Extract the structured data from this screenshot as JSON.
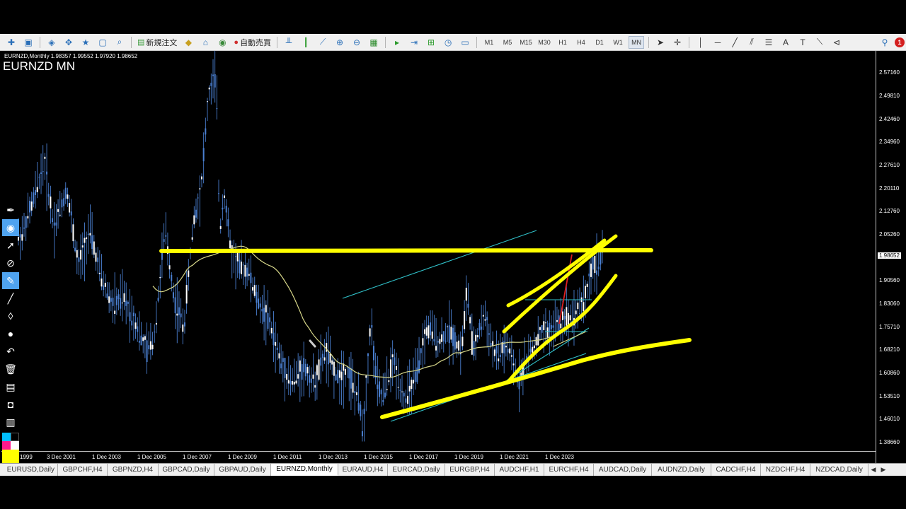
{
  "toolbar": {
    "new_order_label": "新規注文",
    "auto_trading_label": "自動売買",
    "timeframes": [
      "M1",
      "M5",
      "M15",
      "M30",
      "H1",
      "H4",
      "D1",
      "W1",
      "MN"
    ],
    "active_timeframe": "MN",
    "notification_count": "1"
  },
  "chart": {
    "info_line": "EURNZD,Monthly  1.98357 1.99552 1.97920 1.98652",
    "title": "EURNZD MN",
    "current_price": "1.98652",
    "price_labels": [
      "2.57160",
      "2.49810",
      "2.42460",
      "2.34960",
      "2.27610",
      "2.20110",
      "2.12760",
      "2.05260",
      "1.98652",
      "1.90560",
      "1.83060",
      "1.75710",
      "1.68210",
      "1.60860",
      "1.53510",
      "1.46010",
      "1.38660"
    ],
    "time_labels": [
      "1999",
      "3 Dec 2001",
      "1 Dec 2003",
      "1 Dec 2005",
      "1 Dec 2007",
      "1 Dec 2009",
      "1 Dec 2011",
      "1 Dec 2013",
      "1 Dec 2015",
      "1 Dec 2017",
      "1 Dec 2019",
      "1 Dec 2021",
      "1 Dec 2023"
    ],
    "colors": {
      "background": "#000000",
      "candles": "#4a7fd0",
      "moving_average": "#d8d88a",
      "highlighter": "#ffff00",
      "trendline": "#30c0c8",
      "recent_leg": "#e02020"
    }
  },
  "chart_data": {
    "type": "candlestick",
    "symbol": "EURNZD",
    "timeframe": "Monthly",
    "ylim": [
      1.3866,
      2.5716
    ],
    "open": 1.98357,
    "high": 1.99552,
    "low": 1.9792,
    "close": 1.98652,
    "series": [
      {
        "x": [
          "2000-01",
          "2000-07",
          "2001-01",
          "2001-06",
          "2002-01",
          "2002-07",
          "2003-01",
          "2003-07",
          "2004-01",
          "2004-07",
          "2005-01",
          "2005-07",
          "2005-11",
          "2006-05",
          "2006-10",
          "2007-03",
          "2007-08",
          "2007-12",
          "2008-04",
          "2008-08",
          "2008-10",
          "2008-12",
          "2009-04",
          "2009-08",
          "2010-01",
          "2010-06",
          "2010-12",
          "2011-06",
          "2011-12",
          "2012-06",
          "2012-12",
          "2013-06",
          "2013-12",
          "2014-06",
          "2014-12",
          "2015-02",
          "2015-06",
          "2015-09",
          "2015-12",
          "2016-06",
          "2016-12",
          "2017-06",
          "2017-12",
          "2018-06",
          "2018-12",
          "2019-06",
          "2019-09",
          "2019-12",
          "2020-06",
          "2020-12",
          "2021-06",
          "2021-12",
          "2022-06",
          "2022-12",
          "2023-06",
          "2023-12",
          "2024-06",
          "2024-12",
          "2025-03",
          "2025-06",
          "2025-09"
        ],
        "values": [
          2.05,
          2.16,
          2.29,
          2.08,
          2.2,
          1.95,
          2.07,
          1.92,
          1.83,
          1.85,
          1.78,
          1.68,
          1.72,
          2.07,
          1.84,
          1.76,
          2.1,
          2.2,
          2.5,
          2.57,
          2.05,
          2.2,
          2.0,
          1.95,
          1.94,
          1.84,
          1.78,
          1.65,
          1.58,
          1.63,
          1.58,
          1.68,
          1.6,
          1.62,
          1.51,
          1.43,
          1.78,
          1.58,
          1.53,
          1.65,
          1.52,
          1.6,
          1.76,
          1.71,
          1.75,
          1.68,
          1.88,
          1.68,
          1.8,
          1.66,
          1.7,
          1.59,
          1.67,
          1.74,
          1.75,
          1.79,
          1.8,
          1.86,
          1.95,
          1.96,
          1.99
        ]
      }
    ]
  },
  "draw_tools": [
    "pen-icon",
    "eye-icon",
    "cursor-icon",
    "eraser-icon",
    "highlighter-icon",
    "line-icon",
    "ruler-icon",
    "dot-icon",
    "undo-icon",
    "trash-icon",
    "bus-icon",
    "camera-icon",
    "clipboard-icon"
  ],
  "tabs": [
    "EURUSD,Daily",
    "GBPCHF,H4",
    "GBPNZD,H4",
    "GBPCAD,Daily",
    "GBPAUD,Daily",
    "EURNZD,Monthly",
    "EURAUD,H4",
    "EURCAD,Daily",
    "EURGBP,H4",
    "AUDCHF,H1",
    "EURCHF,H4",
    "AUDCAD,Daily",
    "AUDNZD,Daily",
    "CADCHF,H4",
    "NZDCHF,H4",
    "NZDCAD,Daily"
  ],
  "active_tab": "EURNZD,Monthly"
}
